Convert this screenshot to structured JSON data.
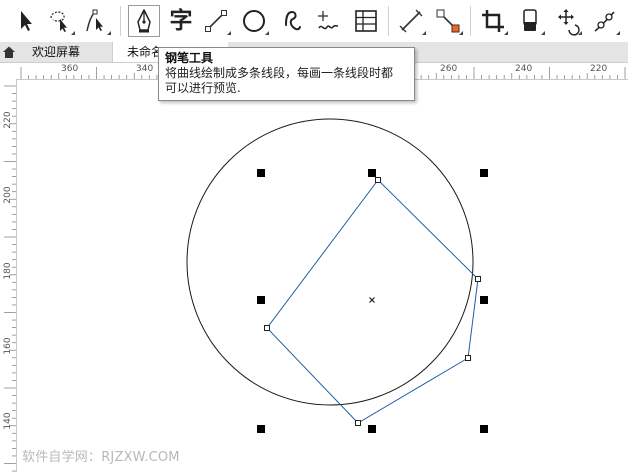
{
  "toolbar": {
    "tools": [
      {
        "name": "pick-tool",
        "icon": "pick-arrow-icon",
        "has_flyout": false
      },
      {
        "name": "freehand-pick-tool",
        "icon": "freehand-pick-icon",
        "has_flyout": true
      },
      {
        "name": "shape-tool",
        "icon": "shape-node-icon",
        "has_flyout": true
      },
      {
        "name": "pen-tool",
        "icon": "pen-nib-icon",
        "has_flyout": false,
        "active": true
      },
      {
        "name": "text-tool",
        "icon": "text-char-icon",
        "label": "字",
        "has_flyout": false
      },
      {
        "name": "two-point-line-tool",
        "icon": "line-icon",
        "has_flyout": true
      },
      {
        "name": "ellipse-tool",
        "icon": "ellipse-icon",
        "has_flyout": true
      },
      {
        "name": "spiral-tool",
        "icon": "spiral-curve-icon",
        "has_flyout": false
      },
      {
        "name": "artistic-media-tool",
        "icon": "artistic-media-icon",
        "has_flyout": false
      },
      {
        "name": "table-tool",
        "icon": "table-grid-icon",
        "has_flyout": false
      },
      {
        "name": "dimension-tool",
        "icon": "dimension-line-icon",
        "has_flyout": true
      },
      {
        "name": "connector-tool",
        "icon": "connector-icon",
        "has_flyout": true
      },
      {
        "name": "crop-tool",
        "icon": "crop-icon",
        "has_flyout": true
      },
      {
        "name": "eraser-tool",
        "icon": "eraser-icon",
        "has_flyout": true
      },
      {
        "name": "transform-tool",
        "icon": "transform-icon",
        "has_flyout": true
      },
      {
        "name": "knife-tool",
        "icon": "knife-icon",
        "has_flyout": true
      }
    ]
  },
  "tabs": {
    "home_icon": "home-icon",
    "welcome_label": "欢迎屏幕",
    "document_label": "未命名"
  },
  "ruler_top": {
    "labels": [
      "360",
      "340",
      "260",
      "240",
      "220"
    ]
  },
  "ruler_left": {
    "labels": [
      "220",
      "200",
      "180",
      "160",
      "140"
    ]
  },
  "tooltip": {
    "title": "钢笔工具",
    "line1": "将曲线绘制成多条线段，每画一条线段时都",
    "line2": "可以进行预览."
  },
  "watermark": "软件自学网：RJZXW.COM",
  "colors": {
    "path_stroke": "#1f5fa6",
    "circle_stroke": "#1a1a1a",
    "handle_fill": "#000000",
    "accent_orange": "#f26522"
  }
}
